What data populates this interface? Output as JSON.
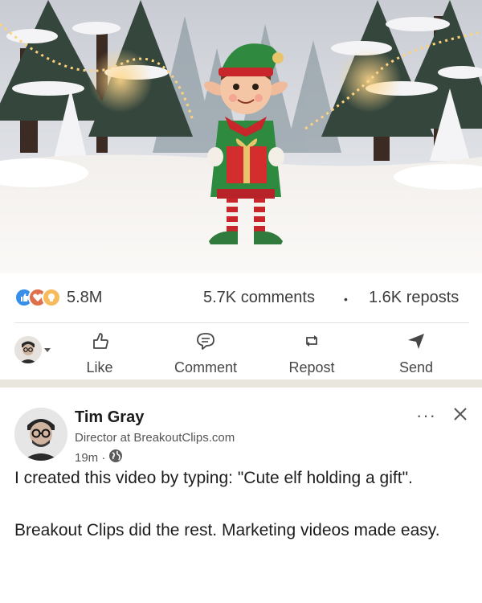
{
  "post_stats": {
    "reaction_count": "5.8M",
    "comments": "5.7K comments",
    "separator": "•",
    "reposts": "1.6K reposts",
    "reaction_icons": [
      "like-icon",
      "heart-icon",
      "lightbulb-icon"
    ]
  },
  "actions": [
    {
      "label": "Like",
      "icon": "thumbs-up-icon"
    },
    {
      "label": "Comment",
      "icon": "comment-icon"
    },
    {
      "label": "Repost",
      "icon": "repost-icon"
    },
    {
      "label": "Send",
      "icon": "send-icon"
    }
  ],
  "comment_post": {
    "author": "Tim Gray",
    "headline": "Director at BreakoutClips.com",
    "time": "19m ·",
    "body_line1": "I created this video by typing: \"Cute elf holding a gift\".",
    "body_line2": "Breakout Clips did the rest. Marketing videos made easy."
  },
  "colors": {
    "like_blue": "#378fe9",
    "heart_red": "#df704d",
    "bulb_yellow": "#f5bb5c",
    "divider": "#e9e6de"
  }
}
